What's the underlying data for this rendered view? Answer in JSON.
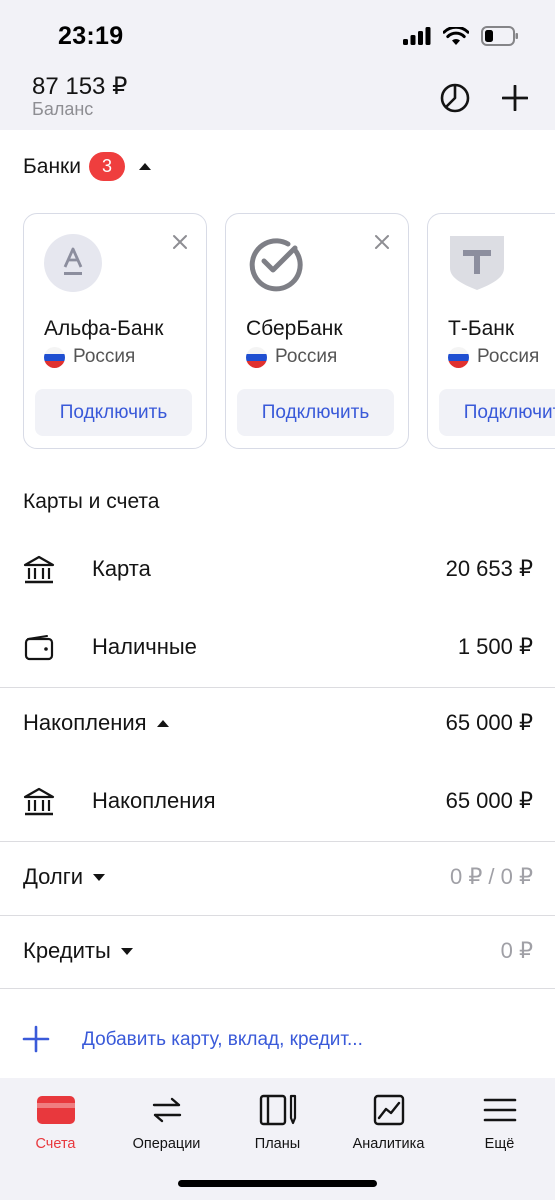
{
  "status_bar": {
    "time": "23:19"
  },
  "header": {
    "balance_amount": "87 153 ₽",
    "balance_label": "Баланс",
    "pie_icon": "pie-chart-icon",
    "add_icon": "plus-icon"
  },
  "banks": {
    "title": "Банки",
    "count": "3",
    "items": [
      {
        "name": "Альфа-Банк",
        "country": "Россия",
        "connect_label": "Подключить",
        "logo": "alfa-bank-logo"
      },
      {
        "name": "СберБанк",
        "country": "Россия",
        "connect_label": "Подключить",
        "logo": "sberbank-logo"
      },
      {
        "name": "Т-Банк",
        "country": "Россия",
        "connect_label": "Подключить",
        "logo": "t-bank-logo"
      }
    ]
  },
  "accounts": {
    "title": "Карты и счета",
    "items": [
      {
        "name": "Карта",
        "amount": "20 653 ₽",
        "icon": "bank-building-icon"
      },
      {
        "name": "Наличные",
        "amount": "1 500 ₽",
        "icon": "wallet-icon"
      }
    ]
  },
  "savings": {
    "title": "Накопления",
    "amount": "65 000 ₽",
    "items": [
      {
        "name": "Накопления",
        "amount": "65 000 ₽",
        "icon": "bank-building-icon"
      }
    ]
  },
  "debts": {
    "title": "Долги",
    "amount": "0 ₽ / 0 ₽"
  },
  "credits": {
    "title": "Кредиты",
    "amount": "0 ₽"
  },
  "add_account": {
    "label": "Добавить карту, вклад, кредит..."
  },
  "tabbar": {
    "tabs": [
      {
        "label": "Счета",
        "icon": "card-icon",
        "active": true
      },
      {
        "label": "Операции",
        "icon": "transfer-arrows-icon",
        "active": false
      },
      {
        "label": "Планы",
        "icon": "planner-icon",
        "active": false
      },
      {
        "label": "Аналитика",
        "icon": "chart-icon",
        "active": false
      },
      {
        "label": "Ещё",
        "icon": "menu-icon",
        "active": false
      }
    ]
  },
  "colors": {
    "accent_red": "#e8383d",
    "badge_red": "#ef3e3e",
    "link_blue": "#3a5ad9",
    "muted_gray": "#a0a0a6",
    "header_bg": "#f2f2f7"
  }
}
